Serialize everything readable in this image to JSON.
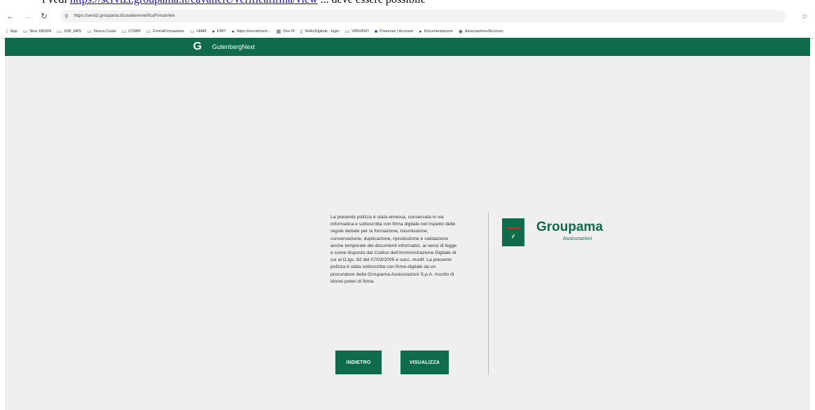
{
  "document_text": {
    "before": "i vedi ",
    "link": "https://servizi.groupama.it/cavaliere/verificafirma/view",
    "after": " ... deve essere possibile"
  },
  "browser": {
    "nav": {
      "back": "←",
      "forward": "→",
      "reload": "↻"
    },
    "url": "https://servizi.groupama.it/cavaliere/verificaFirma/view",
    "bookmarks": [
      {
        "label": "App",
        "icon": "apps-icon"
      },
      {
        "label": "New 180304",
        "icon": "folder-icon"
      },
      {
        "label": "JOB_HRS",
        "icon": "folder-icon"
      },
      {
        "label": "Nuova Costa",
        "icon": "folder-icon"
      },
      {
        "label": "COMM",
        "icon": "folder-icon"
      },
      {
        "label": "FormaFormazione",
        "icon": "folder-icon"
      },
      {
        "label": "HIAM",
        "icon": "folder-icon"
      },
      {
        "label": "FIMT",
        "icon": "globe-icon"
      },
      {
        "label": "https://recruitment...",
        "icon": "globe-icon"
      },
      {
        "label": "One M",
        "icon": "grid-icon"
      },
      {
        "label": "NaNoDigitale - login",
        "icon": "page-icon"
      },
      {
        "label": "VIRGINIO",
        "icon": "folder-icon"
      },
      {
        "label": "Presenze | Accesso",
        "icon": "square-icon"
      },
      {
        "label": "Documentazione",
        "icon": "globe-icon"
      },
      {
        "label": "Associazione/Accesso",
        "icon": "github-icon"
      }
    ]
  },
  "header": {
    "logo_glyph": "G",
    "brand": "GutenbergNext"
  },
  "policy": {
    "text": "La presente polizza è stata emessa, conservata in via informatica e sottoscritta con firma digitale nel rispetto delle regole dettate per la formazione, trasmissione, conservazione, duplicazione, riproduzione e validazione anche temporale dei documenti informatici, ai sensi di legge e come disposto dal Codice dell'Amministrazione Digitale di cui al D.lgs. 82 del 07/03/2005 e succ. modif. La presente polizza è stata sottoscritta con firma digitale da un procuratore della Groupama Assicurazioni S.p.A. munito di idonei poteri di firma.",
    "back_label": "INDIETRO",
    "view_label": "VISUALIZZA"
  },
  "logo": {
    "name": "Groupama",
    "subtitle": "Assicurazioni"
  },
  "colors": {
    "brand_green": "#0f6b4a",
    "page_bg": "#efefef"
  }
}
